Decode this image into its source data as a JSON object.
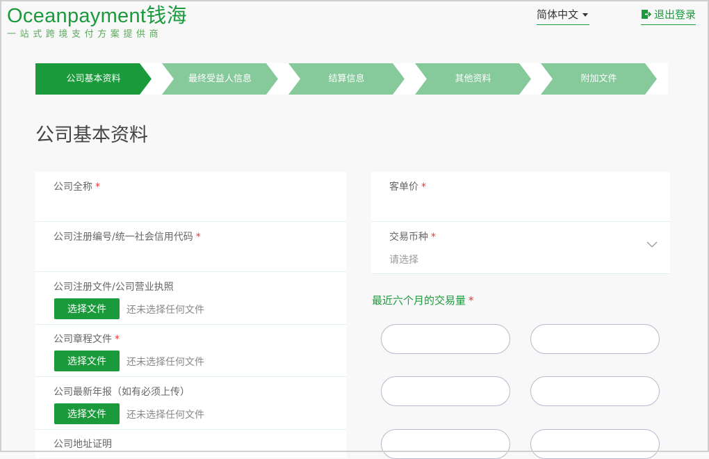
{
  "header": {
    "logo_text": "Oceanpayment钱海",
    "logo_tagline": "一站式跨境支付方案提供商",
    "language": "简体中文",
    "logout": "退出登录"
  },
  "steps": [
    {
      "label": "公司基本资料",
      "active": true
    },
    {
      "label": "最终受益人信息",
      "active": false
    },
    {
      "label": "结算信息",
      "active": false
    },
    {
      "label": "其他资料",
      "active": false
    },
    {
      "label": "附加文件",
      "active": false
    }
  ],
  "page_title": "公司基本资料",
  "left_form": {
    "company_name": {
      "label": "公司全称",
      "required": "*"
    },
    "reg_number": {
      "label": "公司注册编号/统一社会信用代码",
      "required": "*"
    },
    "reg_doc": {
      "label": "公司注册文件/公司营业执照",
      "button": "选择文件",
      "status": "还未选择任何文件"
    },
    "articles": {
      "label": "公司章程文件",
      "required": "*",
      "button": "选择文件",
      "status": "还未选择任何文件"
    },
    "annual_report": {
      "label": "公司最新年报（如有必须上传）",
      "button": "选择文件",
      "status": "还未选择任何文件"
    },
    "address_proof": {
      "label": "公司地址证明"
    }
  },
  "right_form": {
    "avg_order": {
      "label": "客单价",
      "required": "*"
    },
    "currency": {
      "label": "交易币种",
      "required": "*",
      "placeholder": "请选择"
    },
    "volume_title": "最近六个月的交易量",
    "volume_required": "*"
  },
  "colors": {
    "brand": "#1b9a3c",
    "step_inactive": "#86c99b",
    "required": "#e33333"
  }
}
